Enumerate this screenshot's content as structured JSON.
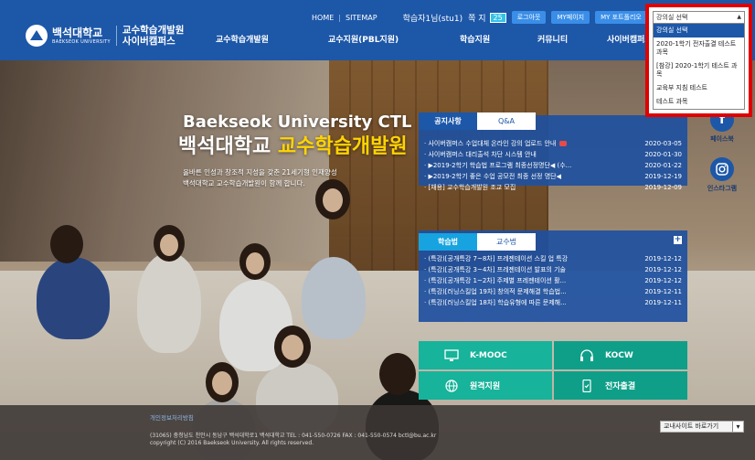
{
  "header": {
    "logo_ko": "백석대학교",
    "logo_en": "BAEKSEOK UNIVERSITY",
    "logo_sub_1": "교수학습개발원",
    "logo_sub_2": "사이버캠퍼스",
    "util_home": "HOME",
    "util_sitemap": "SITEMAP",
    "user_name": "학습자1님(stu1)",
    "note_label": "쪽 지",
    "note_count": "25",
    "logout_label": "로그아웃",
    "mypage_label": "MY페이지",
    "portfolio_label": "MY 포트폴리오",
    "brand_color": "#1d57a8"
  },
  "gnb": {
    "items": [
      "교수학습개발원",
      "교수지원(PBL지원)",
      "학습지원",
      "커뮤니티",
      "사이버캠퍼스"
    ]
  },
  "hero": {
    "title_en": "Baekseok University CTL",
    "title_ko_1": "백석대학교",
    "title_ko_2": "교수학습개발원",
    "desc_1": "올바른 인성과 창조적 지성을 갖춘 21세기형 인재양성",
    "desc_2": "백석대학교 교수학습개발원이 함께 합니다."
  },
  "notice": {
    "tabs": [
      "공지사항",
      "Q&A"
    ],
    "rows": [
      {
        "title": "· 사이버캠퍼스 수업대체 온라인 강의 업로드 안내",
        "date": "2020-03-05",
        "new": true
      },
      {
        "title": "· 사이버캠퍼스 대리출석 차단 시스템 안내",
        "date": "2020-01-30",
        "new": false
      },
      {
        "title": "· ▶2019-2학기 학습법 프로그램 최종선정명단◀ (수...",
        "date": "2020-01-22",
        "new": false
      },
      {
        "title": "· ▶2019-2학기 좋은 수업 공모전 최종 선정 명단◀",
        "date": "2019-12-19",
        "new": false
      },
      {
        "title": "· [채용] 교수학습개발원 조교 모집",
        "date": "2019-12-09",
        "new": false
      }
    ]
  },
  "study": {
    "tabs": [
      "학습법",
      "교수법"
    ],
    "rows": [
      {
        "title": "· (특강)[공개특강 7~8차] 프레젠테이션 스킬 업 특강",
        "date": "2019-12-12"
      },
      {
        "title": "· (특강)[공개특강 3~4차] 프레젠테이션 발표의 기술",
        "date": "2019-12-12"
      },
      {
        "title": "· (특강)[공개특강 1~2차] 주제별 프레젠테이션 활...",
        "date": "2019-12-12"
      },
      {
        "title": "· (특강)[러닝스킬업 19차] 창의적 문제해결 학습법...",
        "date": "2019-12-11"
      },
      {
        "title": "· (특강)[러닝스킬업 18차] 학습유형에 따른 문제해...",
        "date": "2019-12-11"
      }
    ]
  },
  "quick": {
    "kmooc": "K-MOOC",
    "kocw": "KOCW",
    "remote": "원격지원",
    "attendance": "전자출결"
  },
  "social": {
    "facebook": "페이스북",
    "instagram": "인스타그램"
  },
  "dropdown": {
    "header": "강의실 선택",
    "items": [
      "강의실 선택",
      "2020-1학기 전자출결 테스트 과목",
      "[참강] 2020-1학기 테스트 과목",
      "교육부 지침 테스트",
      "테스트 과목"
    ]
  },
  "footer": {
    "policy": "개인정보처리방침",
    "address": "(31065) 충청남도 천안시 동남구 백석대학로1 백석대학교   TEL : 041-550-0726   FAX : 041-550-0574   bctl@bu.ac.kr",
    "copyright": "copyright (C) 2016 Baekseok University. All rights reserved.",
    "family_site": "교내사이트 바로가기"
  }
}
